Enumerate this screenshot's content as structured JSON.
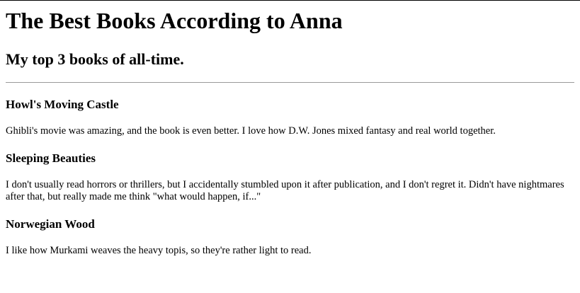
{
  "header": {
    "title": "The Best Books According to Anna",
    "subtitle": "My top 3 books of all-time."
  },
  "books": [
    {
      "title": "Howl's Moving Castle",
      "description": "Ghibli's movie was amazing, and the book is even better. I love how D.W. Jones mixed fantasy and real world together."
    },
    {
      "title": "Sleeping Beauties",
      "description": "I don't usually read horrors or thrillers, but I accidentally stumbled upon it after publication, and I don't regret it. Didn't have nightmares after that, but really made me think \"what would happen, if...\""
    },
    {
      "title": "Norwegian Wood",
      "description": "I like how Murkami weaves the heavy topis, so they're rather light to read."
    }
  ]
}
